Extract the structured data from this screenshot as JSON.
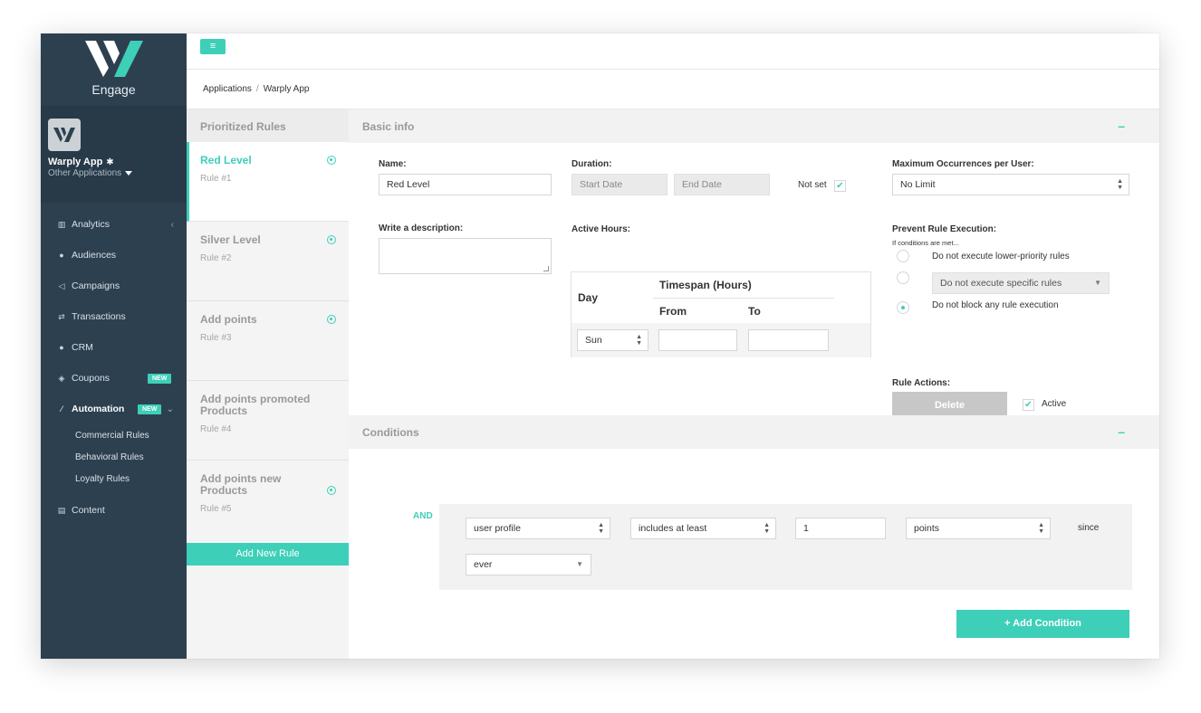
{
  "brand": {
    "name": "Engage"
  },
  "app": {
    "name": "Warply App",
    "other_apps": "Other Applications"
  },
  "nav": {
    "items": [
      {
        "label": "Analytics",
        "icon": "bar-chart-icon"
      },
      {
        "label": "Audiences",
        "icon": "users-icon"
      },
      {
        "label": "Campaigns",
        "icon": "megaphone-icon"
      },
      {
        "label": "Transactions",
        "icon": "exchange-icon"
      },
      {
        "label": "CRM",
        "icon": "user-icon"
      },
      {
        "label": "Coupons",
        "icon": "tag-icon",
        "badge": "NEW"
      },
      {
        "label": "Automation",
        "icon": "wand-icon",
        "badge": "NEW"
      },
      {
        "label": "Content",
        "icon": "file-icon"
      }
    ],
    "sub_items": [
      "Commercial Rules",
      "Behavioral Rules",
      "Loyalty Rules"
    ]
  },
  "breadcrumb": {
    "root": "Applications",
    "sep": "/",
    "current": "Warply App"
  },
  "rules": {
    "header": "Prioritized Rules",
    "items": [
      {
        "title": "Red Level",
        "sub": "Rule #1"
      },
      {
        "title": "Silver Level",
        "sub": "Rule #2"
      },
      {
        "title": "Add points",
        "sub": "Rule #3"
      },
      {
        "title": "Add points promoted Products",
        "sub": "Rule #4"
      },
      {
        "title": "Add points new Products",
        "sub": "Rule #5"
      }
    ],
    "add_button": "Add New Rule"
  },
  "basic_info": {
    "title": "Basic info",
    "collapse": "–",
    "name_label": "Name:",
    "name_value": "Red Level",
    "duration_label": "Duration:",
    "start_placeholder": "Start Date",
    "end_placeholder": "End Date",
    "not_set": "Not set",
    "check_mark": "✔",
    "max_label": "Maximum Occurrences per User:",
    "max_value": "No Limit",
    "desc_label": "Write a description:",
    "hours_label": "Active Hours:",
    "day_header": "Day",
    "timespan_header": "Timespan (Hours)",
    "from_header": "From",
    "to_header": "To",
    "day_value": "Sun",
    "prevent_label": "Prevent Rule Execution:",
    "prevent_hint": "If conditions are met...",
    "option_lower": "Do not execute lower-priority rules",
    "option_specific": "Do not execute specific rules",
    "option_none": "Do not block any rule execution",
    "actions_label": "Rule Actions:",
    "delete": "Delete",
    "active": "Active"
  },
  "conditions": {
    "title": "Conditions",
    "collapse": "–",
    "and": "AND",
    "field": "user profile",
    "operator": "includes at least",
    "amount": "1",
    "unit": "points",
    "since": "since",
    "period": "ever",
    "add_button": "+ Add Condition"
  }
}
